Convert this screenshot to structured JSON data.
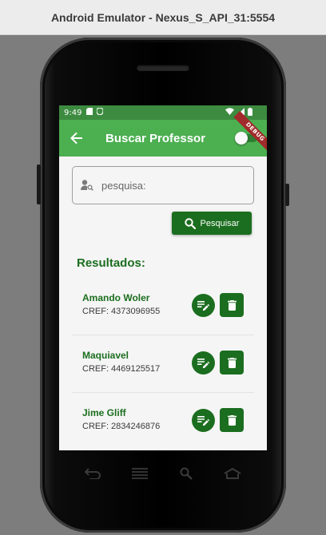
{
  "window": {
    "title": "Android Emulator - Nexus_S_API_31:5554"
  },
  "statusbar": {
    "time": "9:49",
    "debug_banner": "DEBUG"
  },
  "appbar": {
    "title": "Buscar Professor",
    "toggle_on": false
  },
  "search": {
    "placeholder": "pesquisa:",
    "value": "",
    "button_label": "Pesquisar"
  },
  "results": {
    "title": "Resultados:",
    "items": [
      {
        "name": "Amando Woler",
        "cref": "CREF: 4373096955"
      },
      {
        "name": "Maquiavel",
        "cref": "CREF: 4469125517"
      },
      {
        "name": "Jime Gliff",
        "cref": "CREF: 2834246876"
      }
    ]
  },
  "colors": {
    "appbar": "#4caf50",
    "statusbar": "#3d8b40",
    "accent": "#1b6e1f",
    "background": "#f5f5f5"
  },
  "icons": [
    "back-arrow-icon",
    "person-search-icon",
    "search-icon",
    "edit-note-icon",
    "trash-icon",
    "nav-back-icon",
    "nav-menu-icon",
    "nav-search-icon",
    "nav-home-icon"
  ]
}
